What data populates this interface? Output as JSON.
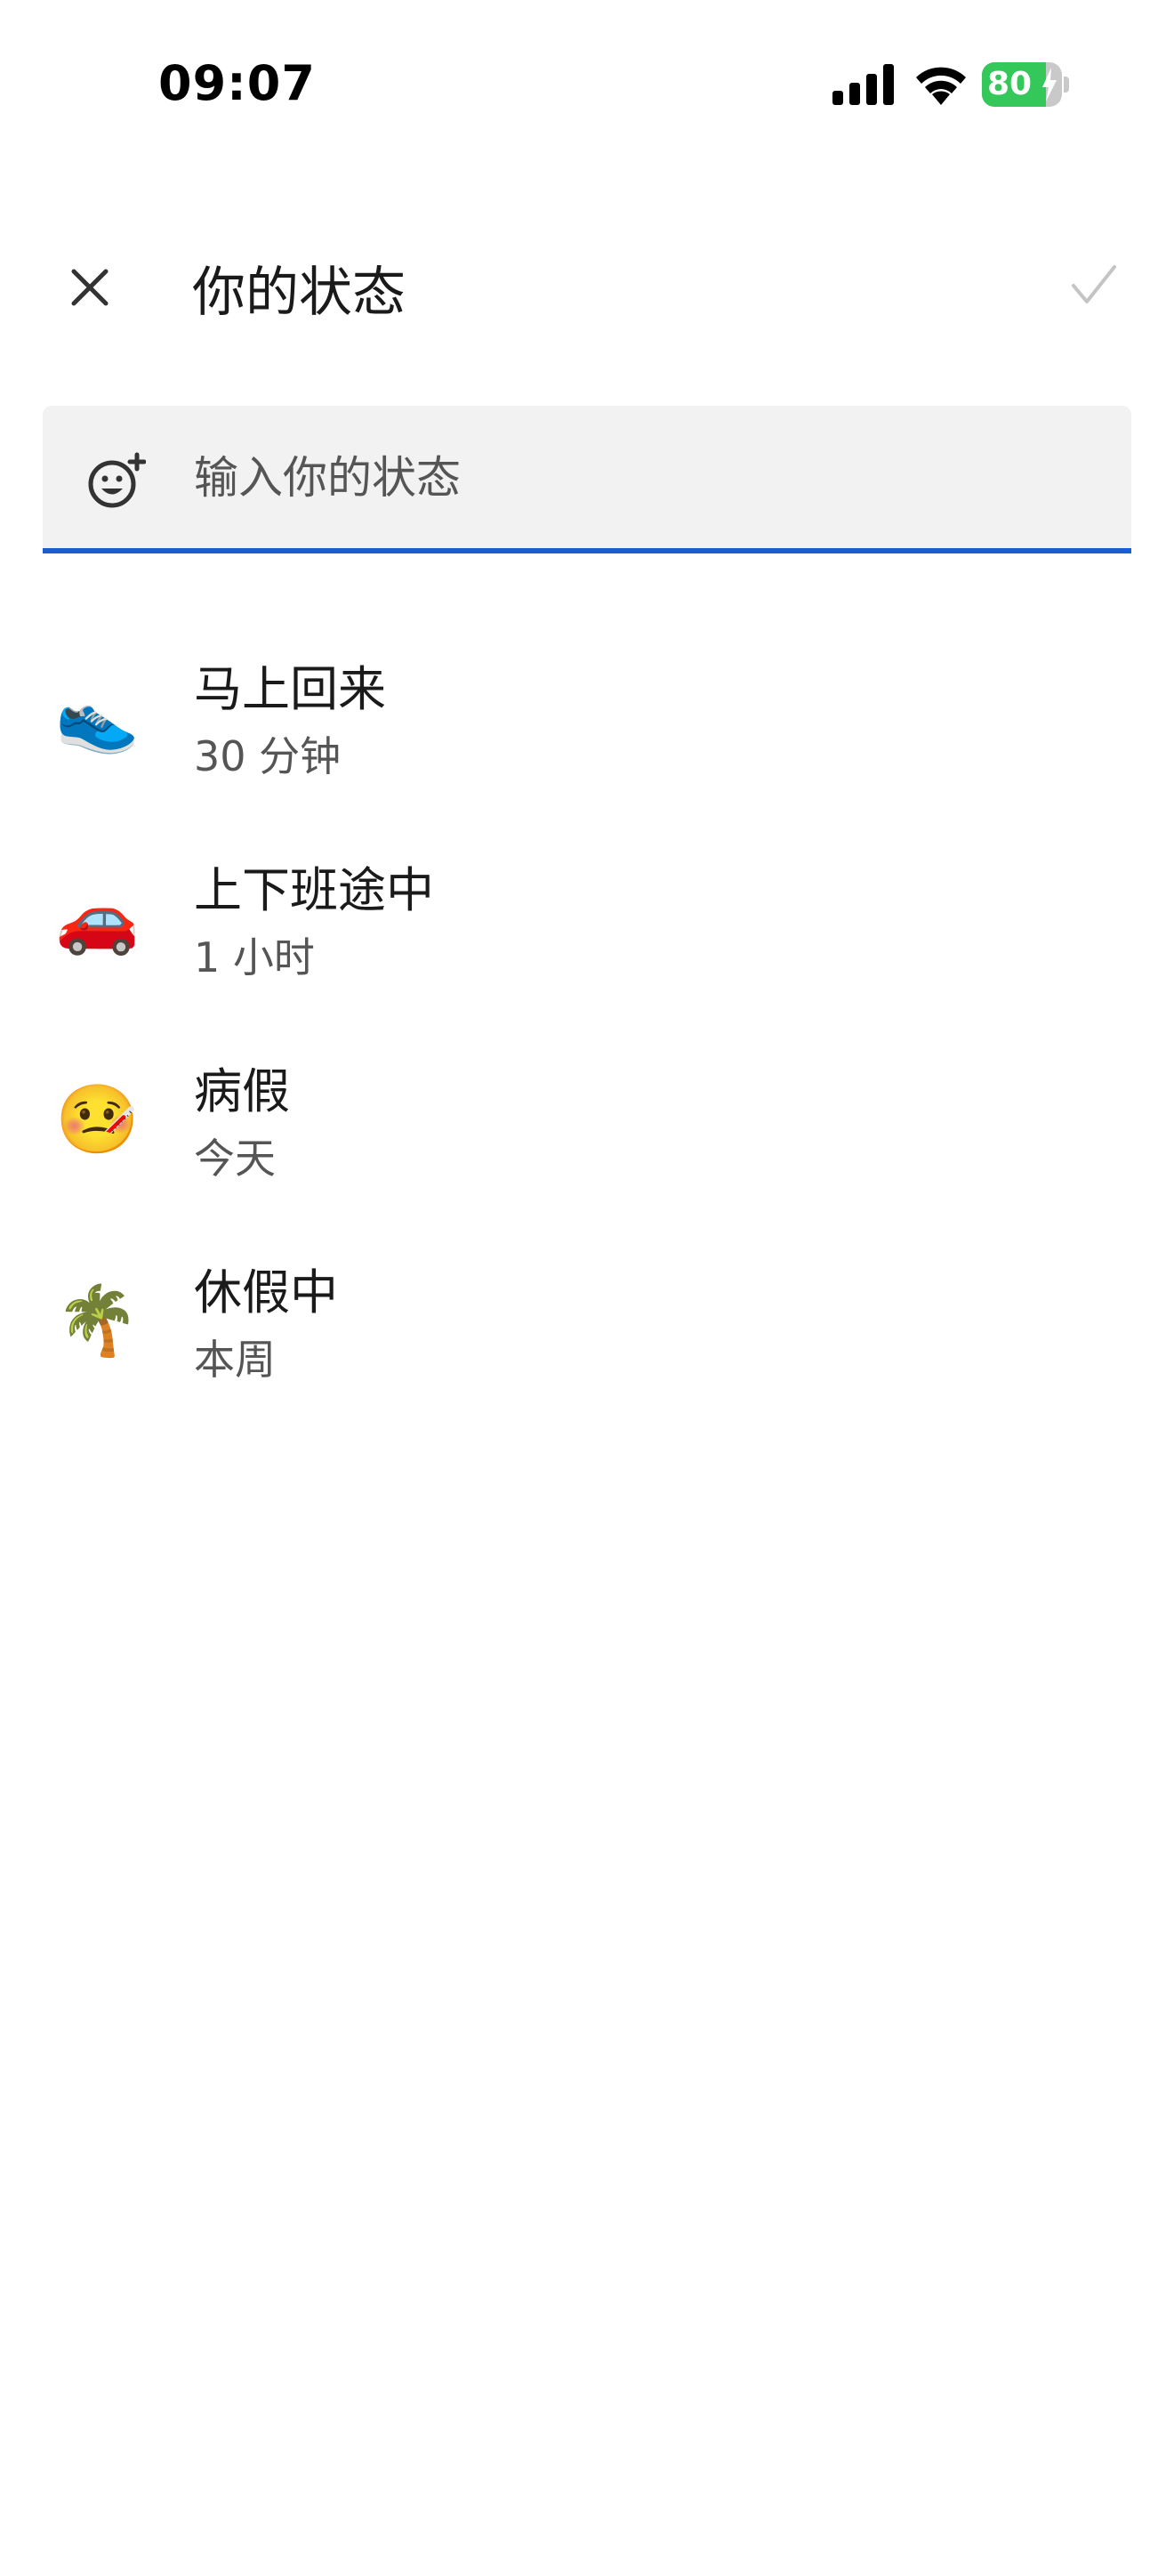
{
  "status_bar": {
    "time": "09:07",
    "battery_level": "80",
    "battery_percent": 80,
    "icons": [
      "signal-icon",
      "wifi-icon",
      "battery-charging-icon"
    ]
  },
  "header": {
    "title": "你的状态",
    "close_icon": "close-icon",
    "confirm_icon": "check-icon"
  },
  "status_input": {
    "placeholder": "输入你的状态",
    "value": "",
    "icon": "emoji-add-icon",
    "accent_color": "#1a5fd0"
  },
  "presets": [
    {
      "emoji": "👟",
      "icon": "sneaker-icon",
      "title": "马上回来",
      "duration": "30 分钟"
    },
    {
      "emoji": "🚗",
      "icon": "car-icon",
      "title": "上下班途中",
      "duration": "1 小时"
    },
    {
      "emoji": "🤒",
      "icon": "thermometer-face-icon",
      "title": "病假",
      "duration": "今天"
    },
    {
      "emoji": "🌴",
      "icon": "palm-tree-icon",
      "title": "休假中",
      "duration": "本周"
    }
  ]
}
